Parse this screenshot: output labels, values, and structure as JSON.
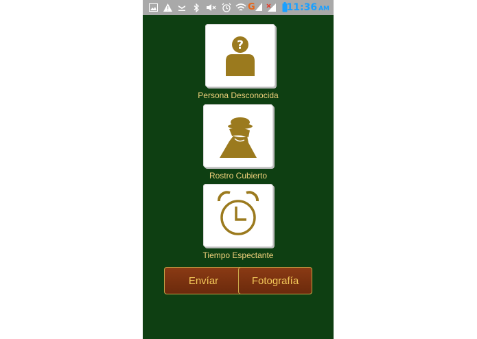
{
  "status_bar": {
    "time": "11:36",
    "ampm": "AM",
    "icons": [
      "image-icon",
      "warning-icon",
      "download-icon",
      "bluetooth-icon",
      "mute-icon",
      "alarm-icon",
      "wifi-icon",
      "signal-g-icon",
      "signal-icon",
      "battery-icon"
    ]
  },
  "options": [
    {
      "label": "Persona Desconocida",
      "icon": "unknown-person-icon"
    },
    {
      "label": "Rostro Cubierto",
      "icon": "covered-face-icon"
    },
    {
      "label": "Tiempo Espectante",
      "icon": "alarm-clock-icon"
    }
  ],
  "buttons": {
    "send": "Envíar",
    "photo": "Fotografía"
  },
  "colors": {
    "background": "#0e3f12",
    "label_text": "#f1d27c",
    "icon": "#9b7a1e",
    "button_bg": "#7a3210",
    "button_text": "#f4c95a",
    "time_text": "#1aa0ff"
  }
}
